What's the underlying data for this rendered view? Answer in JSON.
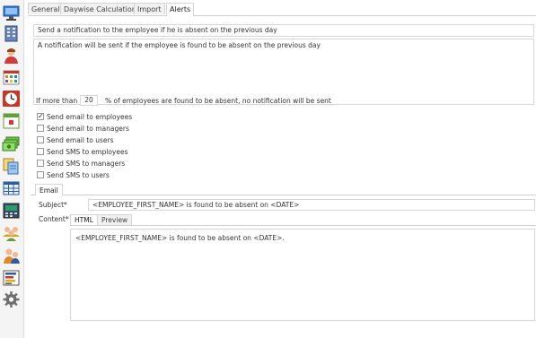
{
  "sidebar": {
    "icons": [
      "monitor-icon",
      "building-icon",
      "person-icon",
      "schedule-grid-icon",
      "clock-icon",
      "calendar-icon",
      "money-icon",
      "documents-icon",
      "table-icon",
      "terminal-icon",
      "group-icon",
      "users-icon",
      "report-icon",
      "settings-icon"
    ]
  },
  "tabs": [
    {
      "label": "General"
    },
    {
      "label": "Daywise Calculation"
    },
    {
      "label": "Import"
    },
    {
      "label": "Alerts"
    }
  ],
  "alerts": {
    "title_value": "Send a notification to the employee if he is absent on the previous day",
    "description_value": "A notification will be sent if the employee is found to be absent on the previous day",
    "threshold_prefix": "If more than",
    "threshold_value": "20",
    "threshold_suffix": "% of employees are found to be absent, no notification will be sent",
    "options": [
      {
        "label": "Send email to employees",
        "checked": true
      },
      {
        "label": "Send email to managers",
        "checked": false
      },
      {
        "label": "Send email to users",
        "checked": false
      },
      {
        "label": "Send SMS to employees",
        "checked": false
      },
      {
        "label": "Send SMS to managers",
        "checked": false
      },
      {
        "label": "Send SMS to users",
        "checked": false
      }
    ]
  },
  "email": {
    "tab_label": "Email",
    "subject_label": "Subject*",
    "subject_value": "<EMPLOYEE_FIRST_NAME> is found to be absent on <DATE>",
    "content_label": "Content*",
    "content_tabs": [
      {
        "label": "HTML"
      },
      {
        "label": "Preview"
      }
    ],
    "content_value": "<EMPLOYEE_FIRST_NAME> is found to be absent on <DATE>."
  }
}
